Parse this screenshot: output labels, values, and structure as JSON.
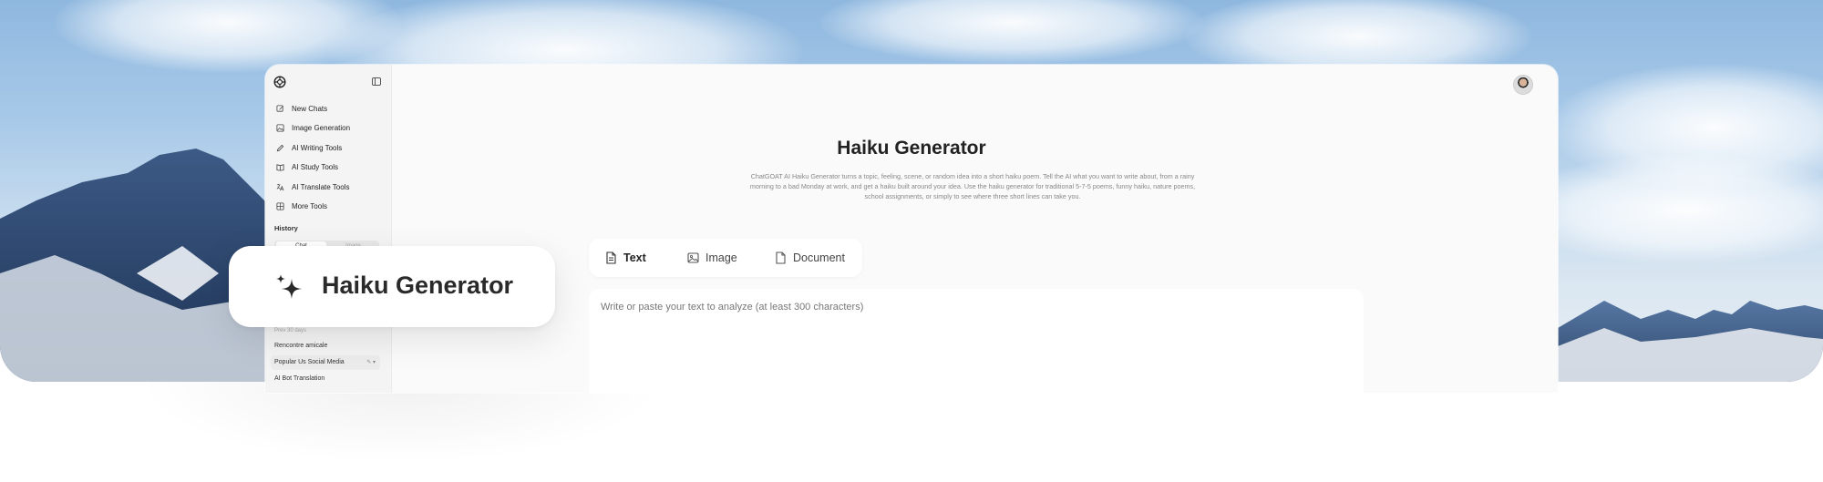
{
  "sidebar": {
    "nav": [
      {
        "label": "New Chats",
        "icon": "edit-icon"
      },
      {
        "label": "Image Generation",
        "icon": "image-icon"
      },
      {
        "label": "AI Writing Tools",
        "icon": "pen-icon"
      },
      {
        "label": "AI Study Tools",
        "icon": "book-icon"
      },
      {
        "label": "AI Translate Tools",
        "icon": "translate-icon"
      },
      {
        "label": "More Tools",
        "icon": "grid-icon"
      }
    ],
    "history_title": "History",
    "history_tabs": [
      "Chat",
      "Image"
    ],
    "history_group": "Prev 30 days",
    "history_items": [
      "Rencontre amicale",
      "Popular Us Social Media",
      "AI Bot Translation"
    ]
  },
  "main": {
    "title": "Haiku Generator",
    "description": "ChatGOAT AI Haiku Generator turns a topic, feeling, scene, or random idea into a short haiku poem. Tell the AI what you want to write about, from a rainy morning to a bad Monday at work, and get a haiku built around your idea. Use the haiku generator for traditional 5-7-5 poems, funny haiku, nature poems, school assignments, or simply to see where three short lines can take you.",
    "tabs": [
      {
        "label": "Text",
        "icon": "file-text-icon"
      },
      {
        "label": "Image",
        "icon": "image-icon"
      },
      {
        "label": "Document",
        "icon": "document-icon"
      }
    ],
    "input_placeholder": "Write or paste your text to analyze (at least 300 characters)"
  },
  "feature_card": {
    "label": "Haiku Generator",
    "icon": "sparkles-icon"
  },
  "colors": {
    "sky": "#a6c8e8",
    "app_bg": "#fafafa",
    "text_primary": "#222222"
  }
}
